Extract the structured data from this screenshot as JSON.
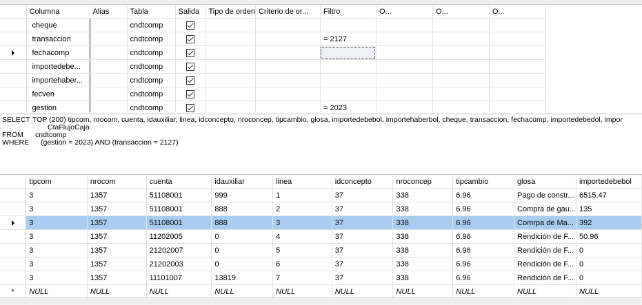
{
  "criteria": {
    "headers": [
      "Columna",
      "Alias",
      "Tabla",
      "Salida",
      "Tipo de orden",
      "Criterio de or...",
      "Filtro",
      "O...",
      "O...",
      "O..."
    ],
    "rows": [
      {
        "columna": "cheque",
        "alias": "",
        "tabla": "cndtcomp",
        "salida": true,
        "filtro": ""
      },
      {
        "columna": "transaccion",
        "alias": "",
        "tabla": "cndtcomp",
        "salida": true,
        "filtro": "= 2127"
      },
      {
        "columna": "fechacomp",
        "alias": "",
        "tabla": "cndtcomp",
        "salida": true,
        "filtro": ""
      },
      {
        "columna": "importedebe...",
        "alias": "",
        "tabla": "cndtcomp",
        "salida": true,
        "filtro": ""
      },
      {
        "columna": "importehaber...",
        "alias": "",
        "tabla": "cndtcomp",
        "salida": true,
        "filtro": ""
      },
      {
        "columna": "fecven",
        "alias": "",
        "tabla": "cndtcomp",
        "salida": true,
        "filtro": ""
      },
      {
        "columna": "gestion",
        "alias": "",
        "tabla": "cndtcomp",
        "salida": true,
        "filtro": "= 2023"
      }
    ]
  },
  "sql": {
    "select_kw": "SELECT",
    "select_text": "TOP (200) tipcom, nrocom, cuenta, idauxiliar, linea, idconcepto, nroconcep, tipcambio, glosa, importedebebol, importehaberbol, cheque, transaccion, fechacomp, importedebedol, impor",
    "select_cont": "CtaFlujoCaja",
    "from_kw": "FROM",
    "from_text": "cndtcomp",
    "where_kw": "WHERE",
    "where_text": "(gestion = 2023) AND (transaccion = 2127)"
  },
  "results": {
    "headers": [
      "tipcom",
      "nrocom",
      "cuenta",
      "idauxiliar",
      "linea",
      "idconcepto",
      "nroconcep",
      "tipcambio",
      "glosa",
      "importedebebol"
    ],
    "rows": [
      [
        "3",
        "1357",
        "51108001",
        "999",
        "1",
        "37",
        "338",
        "6.96",
        "Pago de constr...",
        "6515.47"
      ],
      [
        "3",
        "1357",
        "51108001",
        "888",
        "2",
        "37",
        "338",
        "6.96",
        "Compra de gau...",
        "135"
      ],
      [
        "3",
        "1357",
        "51108001",
        "888",
        "3",
        "37",
        "338",
        "6.96",
        "Comrpa de Ma...",
        "392"
      ],
      [
        "3",
        "1357",
        "11202005",
        "0",
        "4",
        "37",
        "338",
        "6.96",
        "Rendición de F...",
        "50.96"
      ],
      [
        "3",
        "1357",
        "21202007",
        "0",
        "5",
        "37",
        "338",
        "6.96",
        "Rendición de F...",
        "0"
      ],
      [
        "3",
        "1357",
        "21202003",
        "0",
        "6",
        "37",
        "338",
        "6.96",
        "Rendición de F...",
        "0"
      ],
      [
        "3",
        "1357",
        "11101007",
        "13819",
        "7",
        "37",
        "338",
        "6.96",
        "Rendición de F...",
        "0"
      ]
    ],
    "new_row": [
      "NULL",
      "NULL",
      "NULL",
      "NULL",
      "NULL",
      "NULL",
      "NULL",
      "NULL",
      "NULL",
      "NULL"
    ],
    "new_row_marker": "*",
    "selected_row": 2
  }
}
